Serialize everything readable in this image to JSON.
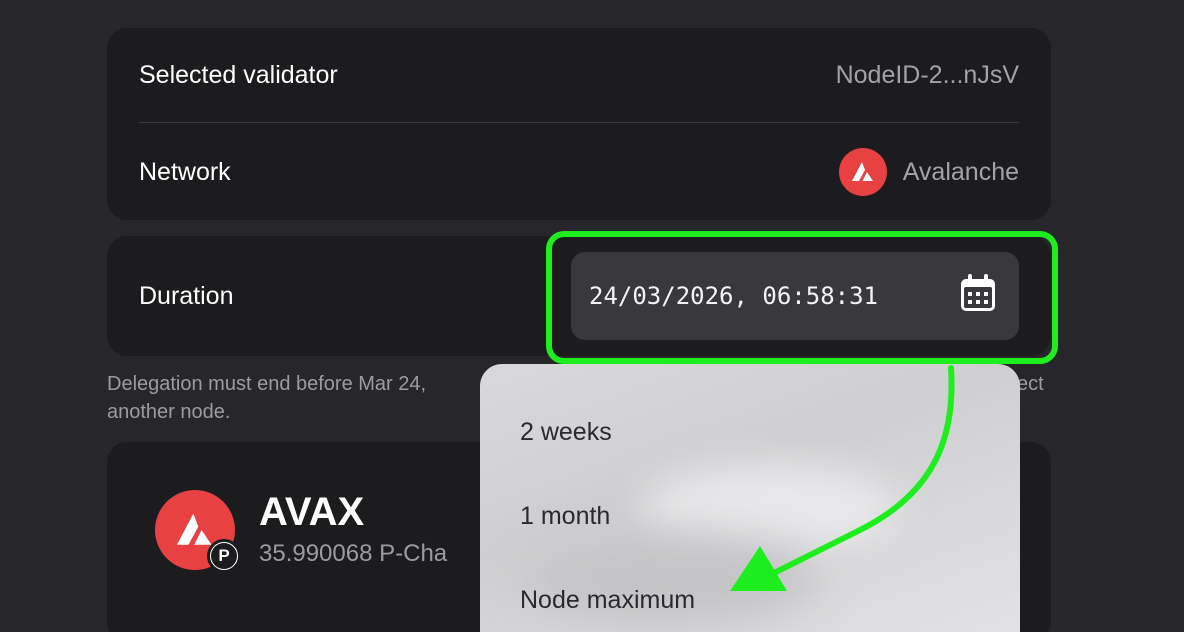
{
  "validator": {
    "label": "Selected validator",
    "value": "NodeID-2...nJsV"
  },
  "network": {
    "label": "Network",
    "value": "Avalanche"
  },
  "duration": {
    "label": "Duration",
    "value": "24/03/2026, 06:58:31"
  },
  "helper": {
    "text_start": "Delegation must end before Mar 24,",
    "text_end": "ect",
    "line2": "another node."
  },
  "token": {
    "name": "AVAX",
    "balance": "35.990068 P-Cha",
    "badge": "P"
  },
  "duration_menu": {
    "items": [
      "2 weeks",
      "1 month",
      "Node maximum"
    ]
  },
  "colors": {
    "accent_red": "#e84142",
    "highlight_green": "#1eee1e",
    "card_bg": "#1c1c1f",
    "page_bg": "#26262b"
  },
  "icons": [
    "avalanche-logo-icon",
    "calendar-icon",
    "p-chain-badge-icon"
  ]
}
